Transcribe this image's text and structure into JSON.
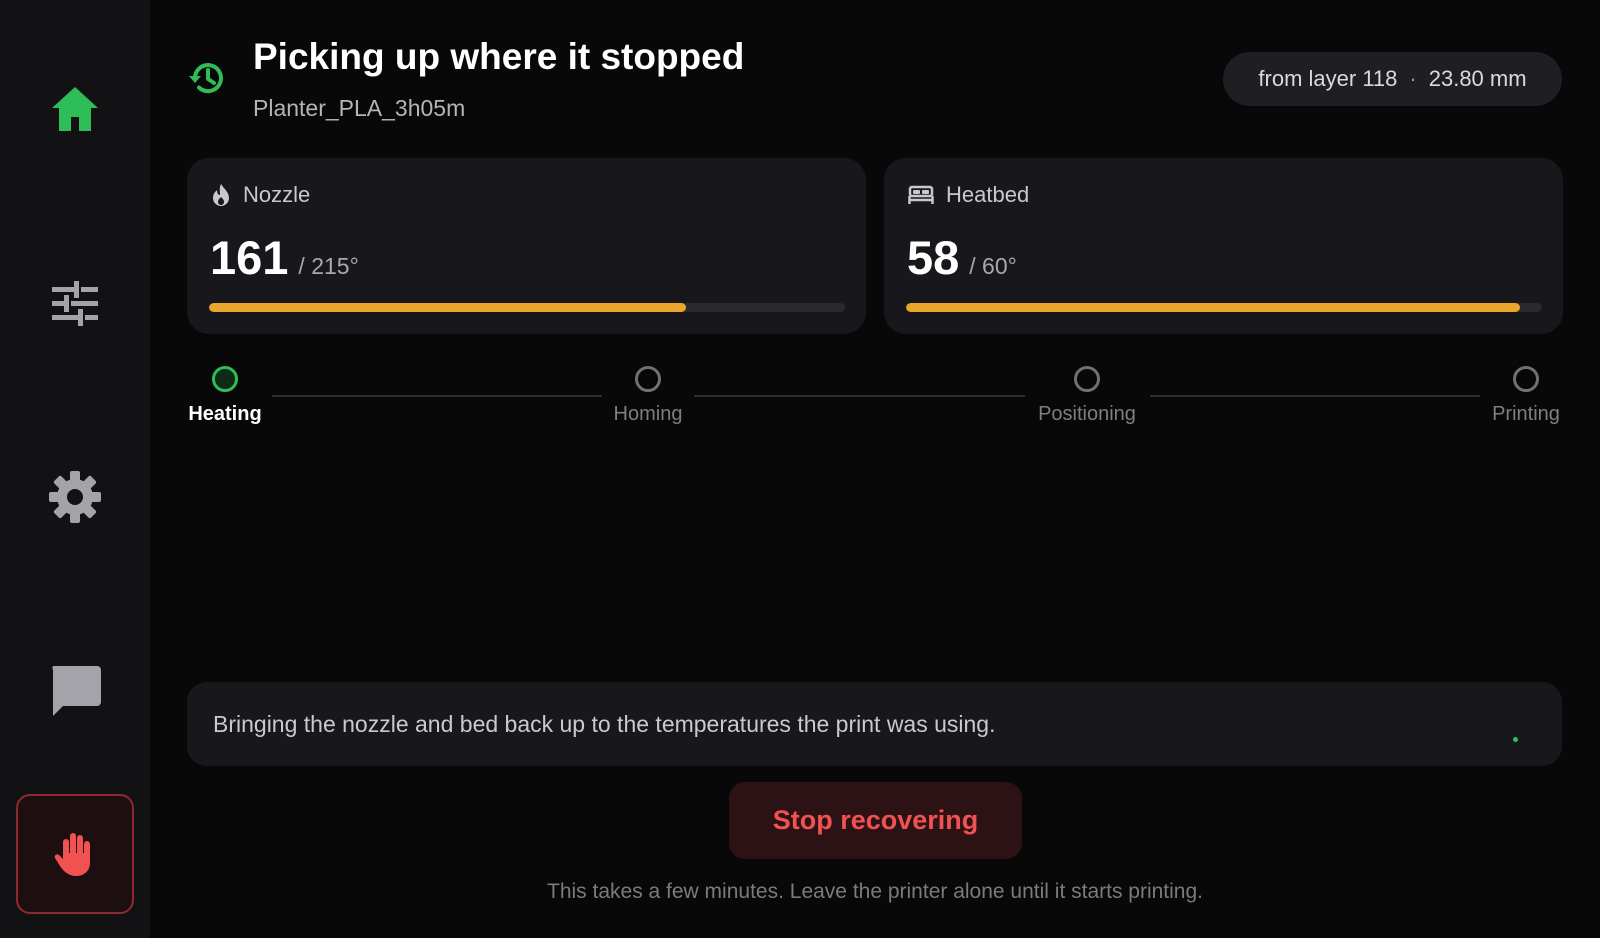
{
  "header": {
    "title": "Picking up where it stopped",
    "subtitle": "Planter_PLA_3h05m",
    "icon": "history-icon",
    "layer_pill": {
      "layer_text": "from layer 118",
      "separator": "·",
      "height_text": "23.80 mm"
    }
  },
  "sidebar": {
    "items": [
      {
        "name": "home",
        "icon": "home-icon",
        "active": true
      },
      {
        "name": "tune",
        "icon": "sliders-icon"
      },
      {
        "name": "settings",
        "icon": "gear-icon"
      },
      {
        "name": "messages",
        "icon": "chat-icon"
      },
      {
        "name": "stop",
        "icon": "hand-stop-icon"
      }
    ]
  },
  "temps": {
    "nozzle": {
      "label": "Nozzle",
      "icon": "flame-icon",
      "current": "161",
      "target": "/ 215°",
      "progress": 0.75
    },
    "heatbed": {
      "label": "Heatbed",
      "icon": "bed-icon",
      "current": "58",
      "target": "/ 60°",
      "progress": 0.966
    }
  },
  "steps": [
    {
      "label": "Heating",
      "active": true
    },
    {
      "label": "Homing",
      "active": false
    },
    {
      "label": "Positioning",
      "active": false
    },
    {
      "label": "Printing",
      "active": false
    }
  ],
  "message": "Bringing the nozzle and bed back up to the temperatures the print was using.",
  "stop_button": "Stop recovering",
  "hint": "This takes a few minutes. Leave the printer alone until it starts printing.",
  "colors": {
    "accent_green": "#2fbd57",
    "progress_orange": "#e9a52c",
    "danger_red": "#f05252",
    "background": "#080809",
    "card": "#18181c"
  }
}
